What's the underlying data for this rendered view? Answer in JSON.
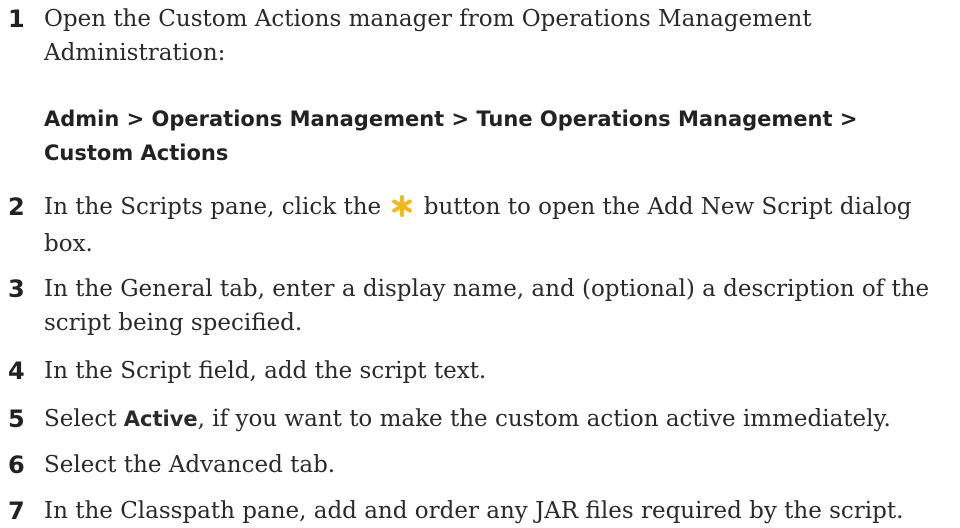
{
  "steps": [
    {
      "num": "1",
      "text": "Open the Custom Actions manager from Operations Management Administration:"
    },
    {
      "num": "2",
      "before": "In the Scripts pane, click the",
      "after": "button to open the Add New Script dialog box.",
      "icon": "new-asterisk-icon"
    },
    {
      "num": "3",
      "text": "In the General tab, enter a display name, and (optional) a description of the script being specified."
    },
    {
      "num": "4",
      "text": "In the Script field, add the script text."
    },
    {
      "num": "5",
      "before": "Select",
      "bold": "Active",
      "after": ", if you want to make the custom action active immediately."
    },
    {
      "num": "6",
      "text": "Select the Advanced tab."
    },
    {
      "num": "7",
      "text": "In the Classpath pane, add and order any JAR files required by the script."
    }
  ],
  "path": {
    "line1": "Admin > Operations Management > Tune Operations Management >",
    "line2": "Custom Actions"
  },
  "colors": {
    "text": "#2a2a2a",
    "icon": "#f2b81c"
  }
}
